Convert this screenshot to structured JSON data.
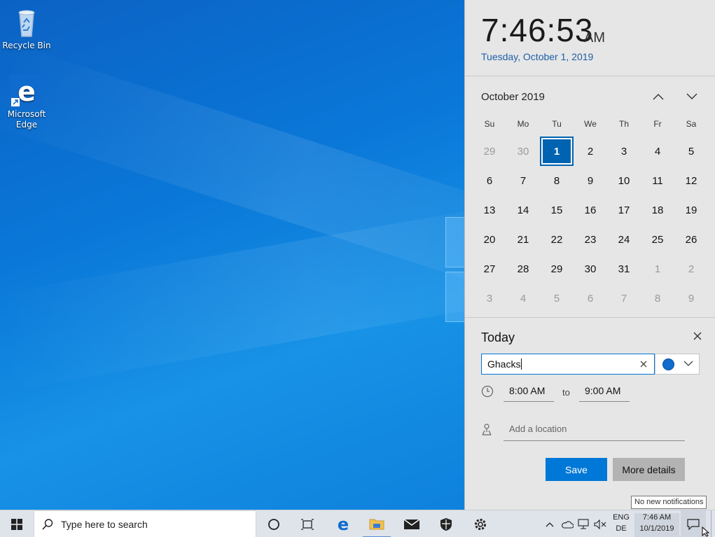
{
  "desktop": {
    "icons": [
      {
        "label": "Recycle Bin"
      },
      {
        "label": "Microsoft Edge"
      }
    ]
  },
  "flyout": {
    "time": "7:46:53",
    "ampm": "AM",
    "date": "Tuesday, October 1, 2019",
    "month_label": "October 2019",
    "weekdays": [
      "Su",
      "Mo",
      "Tu",
      "We",
      "Th",
      "Fr",
      "Sa"
    ],
    "weeks": [
      [
        "29",
        "30",
        "1",
        "2",
        "3",
        "4",
        "5"
      ],
      [
        "6",
        "7",
        "8",
        "9",
        "10",
        "11",
        "12"
      ],
      [
        "13",
        "14",
        "15",
        "16",
        "17",
        "18",
        "19"
      ],
      [
        "20",
        "21",
        "22",
        "23",
        "24",
        "25",
        "26"
      ],
      [
        "27",
        "28",
        "29",
        "30",
        "31",
        "1",
        "2"
      ],
      [
        "3",
        "4",
        "5",
        "6",
        "7",
        "8",
        "9"
      ]
    ],
    "today_label": "Today",
    "event_title": "Ghacks",
    "event_color": "#0f6cce",
    "start_time": "8:00 AM",
    "to_label": "to",
    "end_time": "9:00 AM",
    "location_placeholder": "Add a location",
    "save_label": "Save",
    "more_details_label": "More details"
  },
  "tooltip": "No new notifications",
  "taskbar": {
    "search_placeholder": "Type here to search",
    "language_top": "ENG",
    "language_bottom": "DE",
    "clock_time": "7:46 AM",
    "clock_date": "10/1/2019",
    "pinned": [
      "cortana-icon",
      "task-view-icon",
      "edge-icon",
      "file-explorer-icon",
      "mail-icon",
      "security-icon",
      "settings-icon"
    ],
    "tray": [
      "chevron-up-icon",
      "onedrive-icon",
      "network-icon",
      "volume-muted-icon"
    ]
  },
  "colors": {
    "accent": "#0078d7",
    "selected_day": "#0063b1",
    "flyout_bg": "#e6e6e6",
    "taskbar_bg": "#dfe3ea"
  }
}
